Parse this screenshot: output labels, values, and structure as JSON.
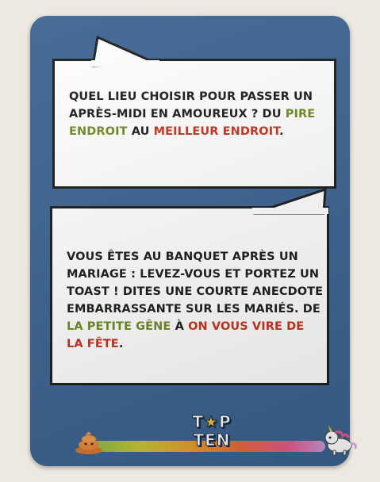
{
  "card": {
    "background_color": "#3c6491",
    "question_1": {
      "part1": "QUEL LIEU CHOISIR POUR PASSER UN APRÈS-MIDI EN AMOUREUX ? DU",
      "low_label": "PIRE ENDROIT",
      "middle": "AU",
      "high_label": "MEILLEUR ENDROIT",
      "end": "."
    },
    "question_2": {
      "part1": "VOUS ÊTES AU BANQUET APRÈS UN MARIAGE : LEVEZ-VOUS ET PORTEZ UN TOAST ! DITES UNE COURTE ANECDOTE EMBARRASSANTE SUR LES MARIÉS. DE",
      "low_label": "LA PETITE GÊNE",
      "middle": "À",
      "high_label": "ON VOUS VIRE DE LA FÊTE",
      "end": "."
    },
    "logo": {
      "line1_part1": "T",
      "line1_part2": "P",
      "line2": "TEN"
    },
    "scale": {
      "low_icon": "poop-icon",
      "high_icon": "unicorn-icon",
      "low_color": "#6f8a22",
      "high_color": "#c8321c"
    }
  }
}
